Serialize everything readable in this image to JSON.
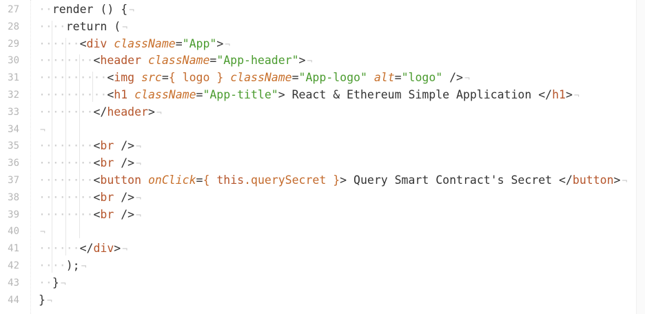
{
  "editor": {
    "colors": {
      "plain": "#333333",
      "tag": "#b5552b",
      "attribute": "#c8702c",
      "string": "#4a9b2e",
      "this_keyword": "#b5552b",
      "expression": "#c36a2c",
      "line_number": "#b6b6b6",
      "invisibles": "#cfcfcf"
    },
    "newline_marker": "¬",
    "lines": [
      {
        "number": "27",
        "indent": 1,
        "tokens": [
          {
            "t": "plain",
            "v": "render () {"
          }
        ]
      },
      {
        "number": "28",
        "indent": 2,
        "tokens": [
          {
            "t": "plain",
            "v": "return ("
          }
        ]
      },
      {
        "number": "29",
        "indent": 3,
        "tokens": [
          {
            "t": "plain",
            "v": "<"
          },
          {
            "t": "tag",
            "v": "div"
          },
          {
            "t": "plain",
            "v": " "
          },
          {
            "t": "attr",
            "v": "className"
          },
          {
            "t": "plain",
            "v": "="
          },
          {
            "t": "str",
            "v": "\"App\""
          },
          {
            "t": "plain",
            "v": ">"
          }
        ]
      },
      {
        "number": "30",
        "indent": 4,
        "tokens": [
          {
            "t": "plain",
            "v": "<"
          },
          {
            "t": "tag",
            "v": "header"
          },
          {
            "t": "plain",
            "v": " "
          },
          {
            "t": "attr",
            "v": "className"
          },
          {
            "t": "plain",
            "v": "="
          },
          {
            "t": "str",
            "v": "\"App-header\""
          },
          {
            "t": "plain",
            "v": ">"
          }
        ]
      },
      {
        "number": "31",
        "indent": 5,
        "tokens": [
          {
            "t": "plain",
            "v": "<"
          },
          {
            "t": "tag",
            "v": "img"
          },
          {
            "t": "plain",
            "v": " "
          },
          {
            "t": "attr",
            "v": "src"
          },
          {
            "t": "plain",
            "v": "="
          },
          {
            "t": "exp",
            "v": "{ logo }"
          },
          {
            "t": "plain",
            "v": " "
          },
          {
            "t": "attr",
            "v": "className"
          },
          {
            "t": "plain",
            "v": "="
          },
          {
            "t": "str",
            "v": "\"App-logo\""
          },
          {
            "t": "plain",
            "v": " "
          },
          {
            "t": "attr",
            "v": "alt"
          },
          {
            "t": "plain",
            "v": "="
          },
          {
            "t": "str",
            "v": "\"logo\""
          },
          {
            "t": "plain",
            "v": " />"
          }
        ]
      },
      {
        "number": "32",
        "indent": 5,
        "tokens": [
          {
            "t": "plain",
            "v": "<"
          },
          {
            "t": "tag",
            "v": "h1"
          },
          {
            "t": "plain",
            "v": " "
          },
          {
            "t": "attr",
            "v": "className"
          },
          {
            "t": "plain",
            "v": "="
          },
          {
            "t": "str",
            "v": "\"App-title\""
          },
          {
            "t": "plain",
            "v": "> React & Ethereum Simple Application </"
          },
          {
            "t": "tag",
            "v": "h1"
          },
          {
            "t": "plain",
            "v": ">"
          }
        ]
      },
      {
        "number": "33",
        "indent": 4,
        "tokens": [
          {
            "t": "plain",
            "v": "</"
          },
          {
            "t": "tag",
            "v": "header"
          },
          {
            "t": "plain",
            "v": ">"
          }
        ]
      },
      {
        "number": "34",
        "indent": 0,
        "tokens": []
      },
      {
        "number": "35",
        "indent": 4,
        "tokens": [
          {
            "t": "plain",
            "v": "<"
          },
          {
            "t": "tag",
            "v": "br"
          },
          {
            "t": "plain",
            "v": " />"
          }
        ]
      },
      {
        "number": "36",
        "indent": 4,
        "tokens": [
          {
            "t": "plain",
            "v": "<"
          },
          {
            "t": "tag",
            "v": "br"
          },
          {
            "t": "plain",
            "v": " />"
          }
        ]
      },
      {
        "number": "37",
        "indent": 4,
        "tokens": [
          {
            "t": "plain",
            "v": "<"
          },
          {
            "t": "tag",
            "v": "button"
          },
          {
            "t": "plain",
            "v": " "
          },
          {
            "t": "attr",
            "v": "onClick"
          },
          {
            "t": "plain",
            "v": "="
          },
          {
            "t": "exp",
            "v": "{ "
          },
          {
            "t": "this",
            "v": "this"
          },
          {
            "t": "exp",
            "v": ".querySecret }"
          },
          {
            "t": "plain",
            "v": "> Query Smart Contract's Secret </"
          },
          {
            "t": "tag",
            "v": "button"
          },
          {
            "t": "plain",
            "v": ">"
          }
        ]
      },
      {
        "number": "38",
        "indent": 4,
        "tokens": [
          {
            "t": "plain",
            "v": "<"
          },
          {
            "t": "tag",
            "v": "br"
          },
          {
            "t": "plain",
            "v": " />"
          }
        ]
      },
      {
        "number": "39",
        "indent": 4,
        "tokens": [
          {
            "t": "plain",
            "v": "<"
          },
          {
            "t": "tag",
            "v": "br"
          },
          {
            "t": "plain",
            "v": " />"
          }
        ]
      },
      {
        "number": "40",
        "indent": 0,
        "tokens": []
      },
      {
        "number": "41",
        "indent": 3,
        "tokens": [
          {
            "t": "plain",
            "v": "</"
          },
          {
            "t": "tag",
            "v": "div"
          },
          {
            "t": "plain",
            "v": ">"
          }
        ]
      },
      {
        "number": "42",
        "indent": 2,
        "tokens": [
          {
            "t": "plain",
            "v": ");"
          }
        ]
      },
      {
        "number": "43",
        "indent": 1,
        "tokens": [
          {
            "t": "plain",
            "v": "}"
          }
        ]
      },
      {
        "number": "44",
        "indent": 0,
        "tokens": [
          {
            "t": "plain",
            "v": "}"
          }
        ]
      }
    ]
  }
}
